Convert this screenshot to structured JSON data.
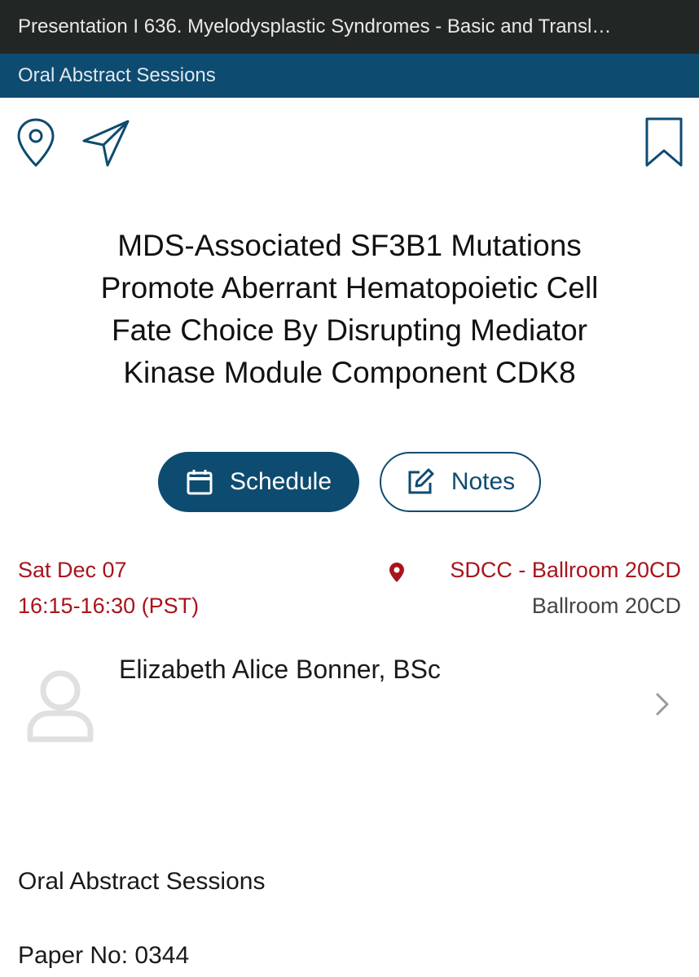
{
  "header": {
    "title": "Presentation I 636. Myelodysplastic Syndromes -  Basic and Transl…",
    "section": "Oral Abstract Sessions"
  },
  "toolbar": {
    "location_icon": "map-pin-icon",
    "share_icon": "send-icon",
    "bookmark_icon": "bookmark-icon"
  },
  "paper": {
    "title_lines": [
      "MDS-Associated SF3B1 Mutations",
      "Promote Aberrant Hematopoietic Cell",
      "Fate Choice By Disrupting Mediator",
      "Kinase Module Component CDK8"
    ]
  },
  "actions": {
    "schedule_label": "Schedule",
    "notes_label": "Notes"
  },
  "session": {
    "date": "Sat Dec 07",
    "time": "16:15-16:30 (PST)",
    "venue": "SDCC - Ballroom 20CD",
    "room": "Ballroom 20CD"
  },
  "speaker": {
    "name": "Elizabeth Alice Bonner, BSc"
  },
  "details": {
    "session_type": "Oral Abstract Sessions",
    "paper_no": "Paper No: 0344"
  },
  "colors": {
    "header_bg": "#222625",
    "brand_blue": "#0e4b70",
    "accent_red": "#a8141b"
  }
}
